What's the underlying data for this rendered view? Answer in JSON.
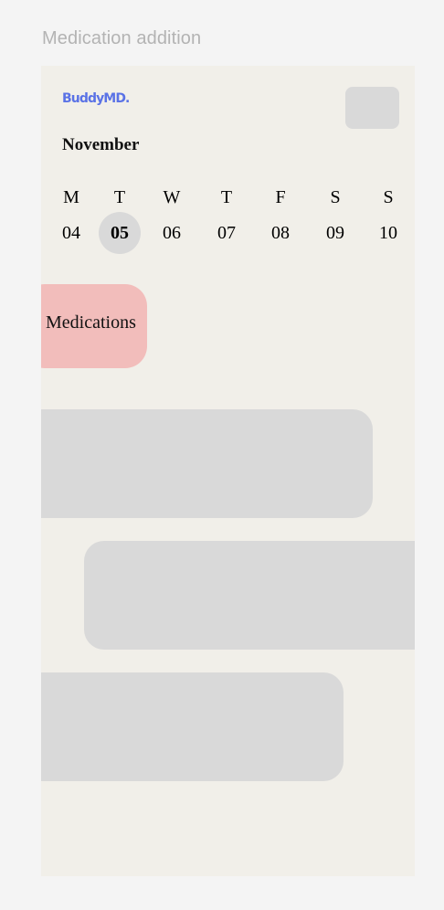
{
  "frame": {
    "label": "Medication addition"
  },
  "app": {
    "logo": "BuddyMD."
  },
  "calendar": {
    "month": "November",
    "days": [
      {
        "letter": "M",
        "date": "04"
      },
      {
        "letter": "T",
        "date": "05",
        "selected": true
      },
      {
        "letter": "W",
        "date": "06"
      },
      {
        "letter": "T",
        "date": "07"
      },
      {
        "letter": "F",
        "date": "08"
      },
      {
        "letter": "S",
        "date": "09"
      },
      {
        "letter": "S",
        "date": "10"
      }
    ]
  },
  "tabs": {
    "medications": "Medications"
  },
  "colors": {
    "background": "#f4f4f4",
    "frame": "#f1efe9",
    "logo": "#5a72e6",
    "placeholder": "#d9d9d9",
    "medications_tab": "#f2bdbb"
  }
}
